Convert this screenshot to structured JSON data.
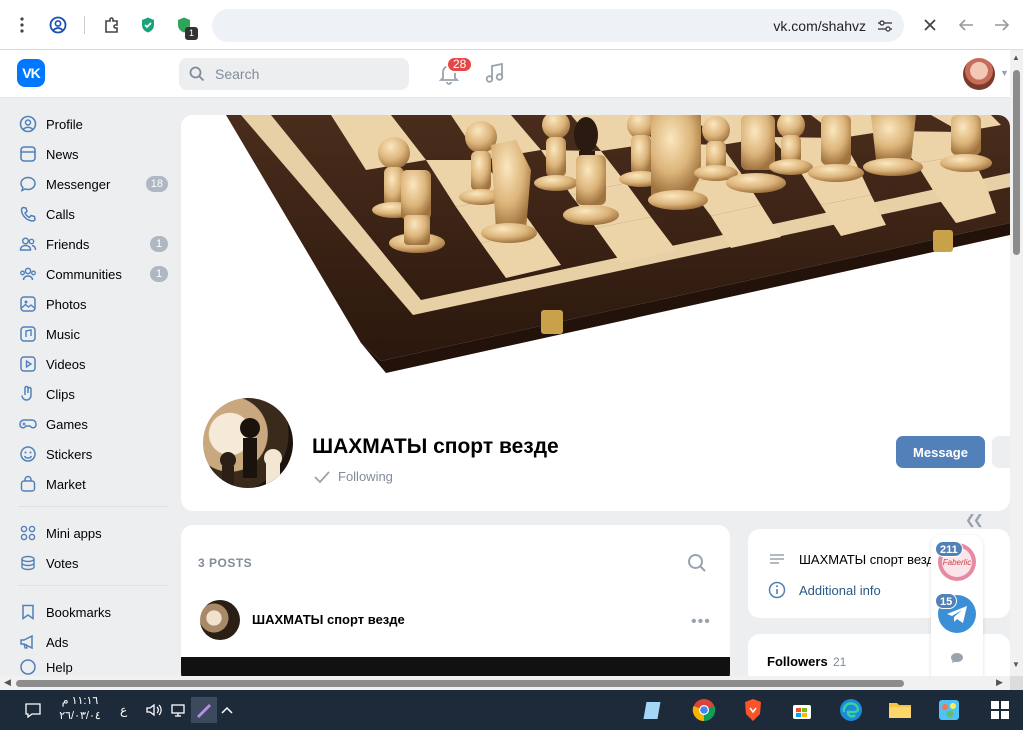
{
  "browser": {
    "url": "vk.com/shahvz",
    "extension_badge": "1"
  },
  "header": {
    "logo": "VK",
    "search_placeholder": "Search",
    "notifications_count": "28"
  },
  "sidebar": {
    "items": [
      {
        "label": "Profile",
        "icon": "user-circle-icon",
        "count": ""
      },
      {
        "label": "News",
        "icon": "news-icon",
        "count": ""
      },
      {
        "label": "Messenger",
        "icon": "chat-bubble-icon",
        "count": "18"
      },
      {
        "label": "Calls",
        "icon": "phone-icon",
        "count": ""
      },
      {
        "label": "Friends",
        "icon": "friends-icon",
        "count": "1"
      },
      {
        "label": "Communities",
        "icon": "communities-icon",
        "count": "1"
      },
      {
        "label": "Photos",
        "icon": "photo-icon",
        "count": ""
      },
      {
        "label": "Music",
        "icon": "music-icon",
        "count": ""
      },
      {
        "label": "Videos",
        "icon": "video-icon",
        "count": ""
      },
      {
        "label": "Clips",
        "icon": "clips-icon",
        "count": ""
      },
      {
        "label": "Games",
        "icon": "gamepad-icon",
        "count": ""
      },
      {
        "label": "Stickers",
        "icon": "smile-icon",
        "count": ""
      },
      {
        "label": "Market",
        "icon": "bag-icon",
        "count": ""
      },
      {
        "label": "Mini apps",
        "icon": "grid-icon",
        "count": ""
      },
      {
        "label": "Votes",
        "icon": "coins-icon",
        "count": ""
      },
      {
        "label": "Bookmarks",
        "icon": "bookmark-icon",
        "count": ""
      },
      {
        "label": "Ads",
        "icon": "megaphone-icon",
        "count": ""
      },
      {
        "label": "Help",
        "icon": "help-icon",
        "count": ""
      }
    ]
  },
  "profile": {
    "name": "ШАХМАТЫ спорт везде",
    "follow_status": "Following",
    "message_button": "Message"
  },
  "posts": {
    "count_label": "3 POSTS",
    "author": "ШАХМАТЫ спорт везде"
  },
  "info": {
    "description": "ШАХМАТЫ спорт везд",
    "additional": "Additional info"
  },
  "followers": {
    "label": "Followers",
    "count": "21"
  },
  "chat_widget": {
    "badge1": "211",
    "badge2": "15",
    "avatar1_text": "Faberlic"
  },
  "taskbar": {
    "time": "١١:١٦ م",
    "date": "٢٦/٠٣/٠٤",
    "lang": "ع"
  },
  "colors": {
    "vk_blue": "#0077ff",
    "button_blue": "#5181b8",
    "badge_red": "#e64646",
    "link": "#2a5885"
  }
}
